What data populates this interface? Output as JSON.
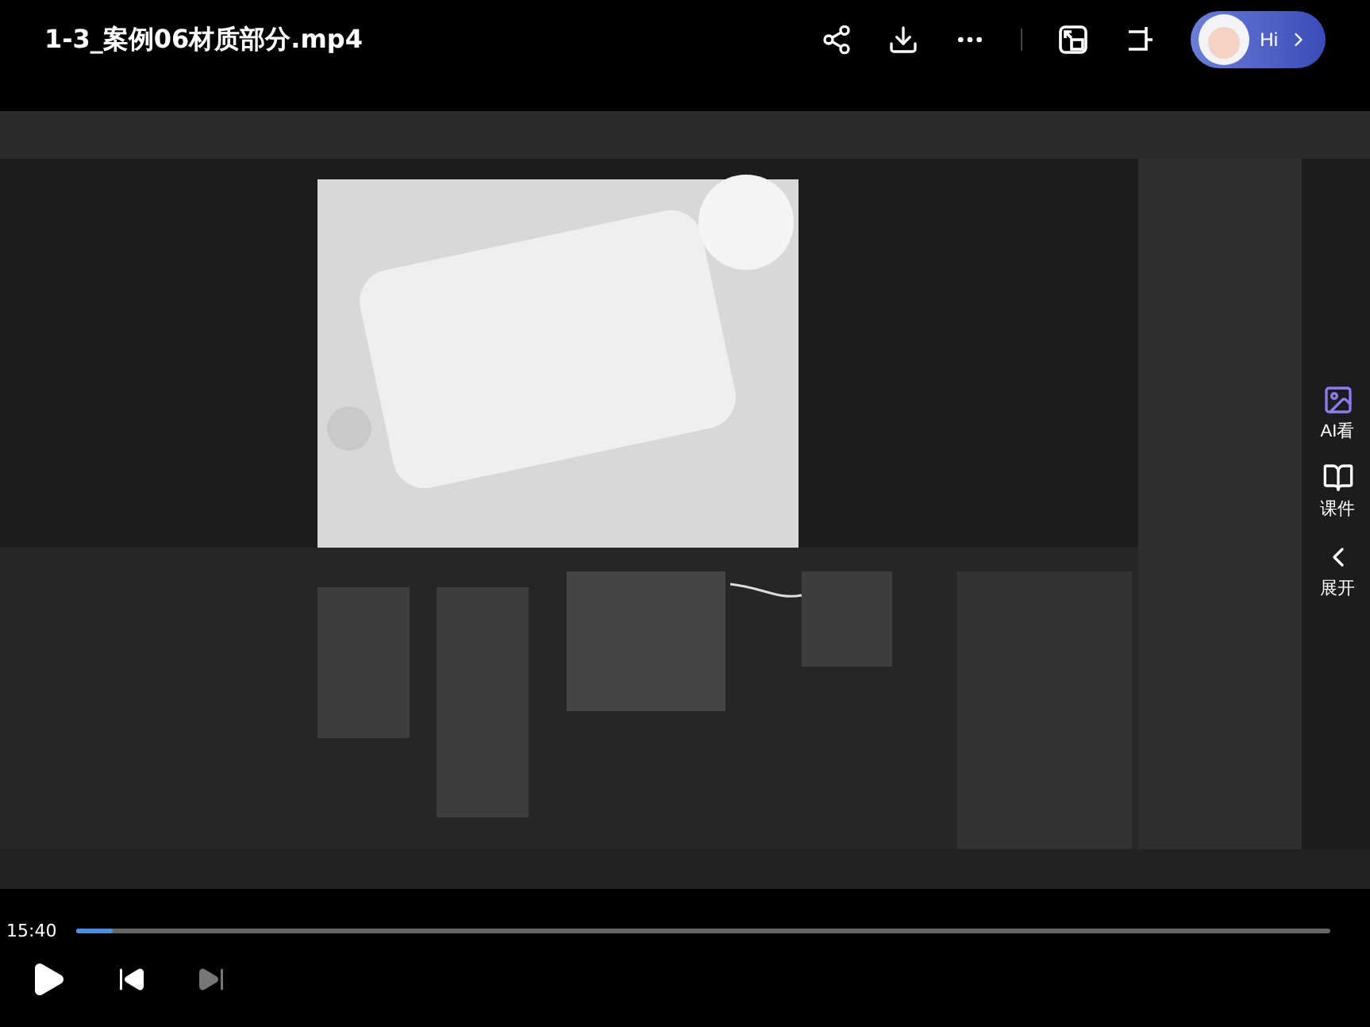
{
  "title": "1-3_案例06材质部分.mp4",
  "assistant": {
    "label": "Hi"
  },
  "side_panel": [
    {
      "kind": "ai",
      "label": "AI看"
    },
    {
      "kind": "notes",
      "label": "课件"
    },
    {
      "kind": "expand",
      "label": "展开"
    }
  ],
  "player": {
    "time": "15:40",
    "progress": {
      "level": 0.03
    },
    "next_disabled": true
  }
}
